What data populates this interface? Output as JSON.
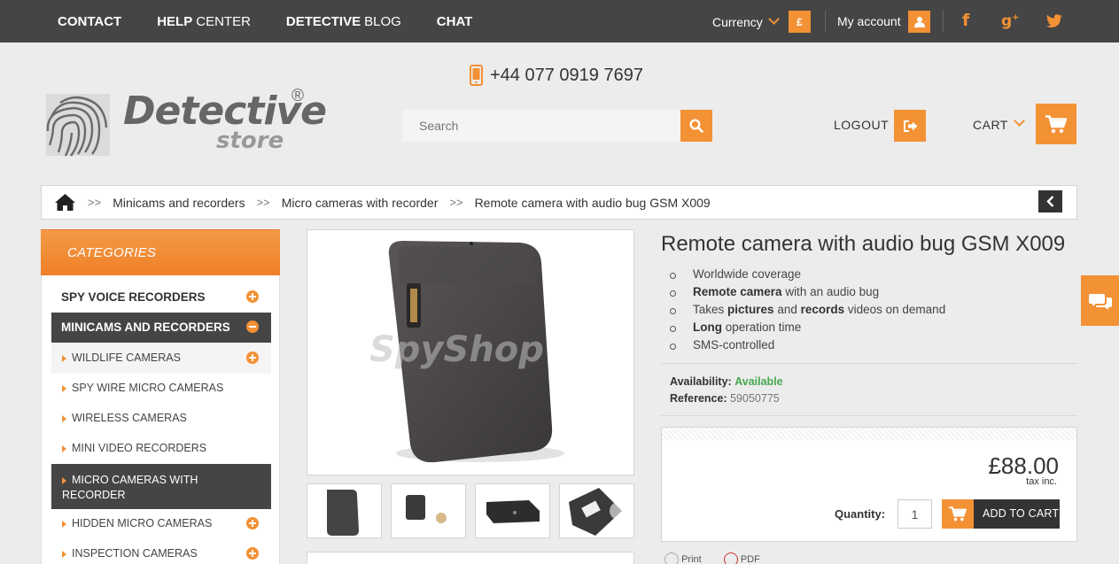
{
  "topbar": {
    "nav": [
      {
        "bold": "CONTACT",
        "light": ""
      },
      {
        "bold": "HELP",
        "light": "CENTER"
      },
      {
        "bold": "DETECTIVE",
        "light": "BLOG"
      },
      {
        "bold": "CHAT",
        "light": ""
      }
    ],
    "currency_label": "Currency",
    "currency_symbol": "£",
    "my_account_label": "My account",
    "social": [
      "facebook-icon",
      "google-plus-icon",
      "twitter-icon"
    ]
  },
  "header": {
    "phone": "+44 077 0919 7697",
    "logo_main": "Detective",
    "logo_sub": "store",
    "logo_reg": "®",
    "search_placeholder": "Search",
    "logout_label": "LOGOUT",
    "cart_label": "CART"
  },
  "breadcrumb": {
    "separator": ">>",
    "items": [
      "Minicams and recorders",
      "Micro cameras with recorder",
      "Remote camera with audio bug GSM X009"
    ]
  },
  "sidebar": {
    "title": "CATEGORIES",
    "items": [
      {
        "label": "SPY VOICE RECORDERS",
        "level": "top",
        "state": "collapsed"
      },
      {
        "label": "MINICAMS AND RECORDERS",
        "level": "top",
        "state": "expanded"
      },
      {
        "label": "WILDLIFE CAMERAS",
        "level": "sub",
        "state": "collapsed"
      },
      {
        "label": "SPY WIRE MICRO CAMERAS",
        "level": "sub",
        "state": "none"
      },
      {
        "label": "WIRELESS CAMERAS",
        "level": "sub",
        "state": "none"
      },
      {
        "label": "MINI VIDEO RECORDERS",
        "level": "sub",
        "state": "none"
      },
      {
        "label": "MICRO CAMERAS WITH RECORDER",
        "level": "sub",
        "state": "active"
      },
      {
        "label": "HIDDEN MICRO CAMERAS",
        "level": "sub",
        "state": "collapsed"
      },
      {
        "label": "INSPECTION CAMERAS",
        "level": "sub",
        "state": "collapsed"
      }
    ]
  },
  "product": {
    "image_watermark": "SpyShop",
    "title": "Remote camera with audio bug GSM X009",
    "features": [
      [
        {
          "t": "Worldwide coverage",
          "b": false
        }
      ],
      [
        {
          "t": "Remote camera",
          "b": true
        },
        {
          "t": " with an audio bug",
          "b": false
        }
      ],
      [
        {
          "t": "Takes ",
          "b": false
        },
        {
          "t": "pictures",
          "b": true
        },
        {
          "t": " and ",
          "b": false
        },
        {
          "t": "records",
          "b": true
        },
        {
          "t": " videos on demand",
          "b": false
        }
      ],
      [
        {
          "t": "Long",
          "b": true
        },
        {
          "t": " operation time",
          "b": false
        }
      ],
      [
        {
          "t": "SMS-controlled",
          "b": false
        }
      ]
    ],
    "availability_label": "Availability:",
    "availability_value": "Available",
    "reference_label": "Reference:",
    "reference_value": "59050775",
    "price": "£88.00",
    "tax_note": "tax inc.",
    "quantity_label": "Quantity:",
    "quantity_value": "1",
    "add_to_cart_label": "ADD TO CART",
    "print_label": "Print",
    "pdf_label": "PDF"
  },
  "colors": {
    "accent": "#f39135",
    "dark": "#454545",
    "available": "#46a74e"
  }
}
